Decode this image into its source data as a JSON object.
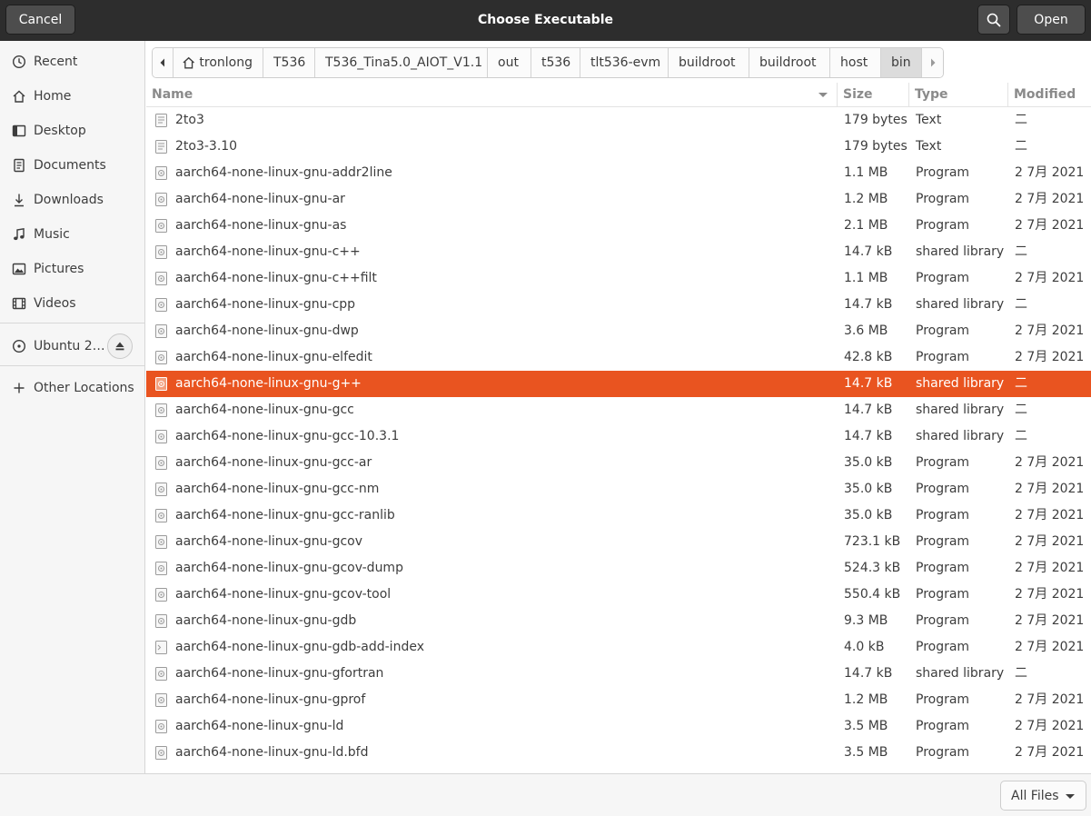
{
  "header": {
    "title": "Choose Executable",
    "cancel_label": "Cancel",
    "open_label": "Open",
    "search_icon": "search-icon"
  },
  "sidebar": {
    "items": [
      {
        "label": "Recent",
        "icon": "clock-icon"
      },
      {
        "label": "Home",
        "icon": "home-icon"
      },
      {
        "label": "Desktop",
        "icon": "desktop-icon"
      },
      {
        "label": "Documents",
        "icon": "document-icon"
      },
      {
        "label": "Downloads",
        "icon": "download-icon"
      },
      {
        "label": "Music",
        "icon": "music-icon"
      },
      {
        "label": "Pictures",
        "icon": "picture-icon"
      },
      {
        "label": "Videos",
        "icon": "video-icon"
      }
    ],
    "device": {
      "label": "Ubuntu 2…",
      "icon": "disc-icon"
    },
    "other": {
      "label": "Other Locations",
      "icon": "plus-icon"
    }
  },
  "pathbar": {
    "crumbs": [
      "tronlong",
      "T536",
      "T536_Tina5.0_AIOT_V1.1",
      "out",
      "t536",
      "tlt536-evm",
      "buildroot",
      "buildroot",
      "host",
      "bin"
    ]
  },
  "columns": {
    "name": "Name",
    "size": "Size",
    "type": "Type",
    "modified": "Modified"
  },
  "files": [
    {
      "name": "2to3",
      "size": "179 bytes",
      "type": "Text",
      "modified": "二",
      "icon": "text-file-icon"
    },
    {
      "name": "2to3-3.10",
      "size": "179 bytes",
      "type": "Text",
      "modified": "二",
      "icon": "text-file-icon"
    },
    {
      "name": "aarch64-none-linux-gnu-addr2line",
      "size": "1.1 MB",
      "type": "Program",
      "modified": "2 7月 2021",
      "icon": "program-icon"
    },
    {
      "name": "aarch64-none-linux-gnu-ar",
      "size": "1.2 MB",
      "type": "Program",
      "modified": "2 7月 2021",
      "icon": "program-icon"
    },
    {
      "name": "aarch64-none-linux-gnu-as",
      "size": "2.1 MB",
      "type": "Program",
      "modified": "2 7月 2021",
      "icon": "program-icon"
    },
    {
      "name": "aarch64-none-linux-gnu-c++",
      "size": "14.7 kB",
      "type": "shared library",
      "modified": "二",
      "icon": "program-icon"
    },
    {
      "name": "aarch64-none-linux-gnu-c++filt",
      "size": "1.1 MB",
      "type": "Program",
      "modified": "2 7月 2021",
      "icon": "program-icon"
    },
    {
      "name": "aarch64-none-linux-gnu-cpp",
      "size": "14.7 kB",
      "type": "shared library",
      "modified": "二",
      "icon": "program-icon"
    },
    {
      "name": "aarch64-none-linux-gnu-dwp",
      "size": "3.6 MB",
      "type": "Program",
      "modified": "2 7月 2021",
      "icon": "program-icon"
    },
    {
      "name": "aarch64-none-linux-gnu-elfedit",
      "size": "42.8 kB",
      "type": "Program",
      "modified": "2 7月 2021",
      "icon": "program-icon"
    },
    {
      "name": "aarch64-none-linux-gnu-g++",
      "size": "14.7 kB",
      "type": "shared library",
      "modified": "二",
      "icon": "program-icon",
      "selected": true
    },
    {
      "name": "aarch64-none-linux-gnu-gcc",
      "size": "14.7 kB",
      "type": "shared library",
      "modified": "二",
      "icon": "program-icon"
    },
    {
      "name": "aarch64-none-linux-gnu-gcc-10.3.1",
      "size": "14.7 kB",
      "type": "shared library",
      "modified": "二",
      "icon": "program-icon"
    },
    {
      "name": "aarch64-none-linux-gnu-gcc-ar",
      "size": "35.0 kB",
      "type": "Program",
      "modified": "2 7月 2021",
      "icon": "program-icon"
    },
    {
      "name": "aarch64-none-linux-gnu-gcc-nm",
      "size": "35.0 kB",
      "type": "Program",
      "modified": "2 7月 2021",
      "icon": "program-icon"
    },
    {
      "name": "aarch64-none-linux-gnu-gcc-ranlib",
      "size": "35.0 kB",
      "type": "Program",
      "modified": "2 7月 2021",
      "icon": "program-icon"
    },
    {
      "name": "aarch64-none-linux-gnu-gcov",
      "size": "723.1 kB",
      "type": "Program",
      "modified": "2 7月 2021",
      "icon": "program-icon"
    },
    {
      "name": "aarch64-none-linux-gnu-gcov-dump",
      "size": "524.3 kB",
      "type": "Program",
      "modified": "2 7月 2021",
      "icon": "program-icon"
    },
    {
      "name": "aarch64-none-linux-gnu-gcov-tool",
      "size": "550.4 kB",
      "type": "Program",
      "modified": "2 7月 2021",
      "icon": "program-icon"
    },
    {
      "name": "aarch64-none-linux-gnu-gdb",
      "size": "9.3 MB",
      "type": "Program",
      "modified": "2 7月 2021",
      "icon": "program-icon"
    },
    {
      "name": "aarch64-none-linux-gnu-gdb-add-index",
      "size": "4.0 kB",
      "type": "Program",
      "modified": "2 7月 2021",
      "icon": "script-icon"
    },
    {
      "name": "aarch64-none-linux-gnu-gfortran",
      "size": "14.7 kB",
      "type": "shared library",
      "modified": "二",
      "icon": "program-icon"
    },
    {
      "name": "aarch64-none-linux-gnu-gprof",
      "size": "1.2 MB",
      "type": "Program",
      "modified": "2 7月 2021",
      "icon": "program-icon"
    },
    {
      "name": "aarch64-none-linux-gnu-ld",
      "size": "3.5 MB",
      "type": "Program",
      "modified": "2 7月 2021",
      "icon": "program-icon"
    },
    {
      "name": "aarch64-none-linux-gnu-ld.bfd",
      "size": "3.5 MB",
      "type": "Program",
      "modified": "2 7月 2021",
      "icon": "program-icon"
    }
  ],
  "filter": {
    "label": "All Files"
  },
  "colors": {
    "accent": "#e95420",
    "headerbar": "#2d2d2d"
  }
}
